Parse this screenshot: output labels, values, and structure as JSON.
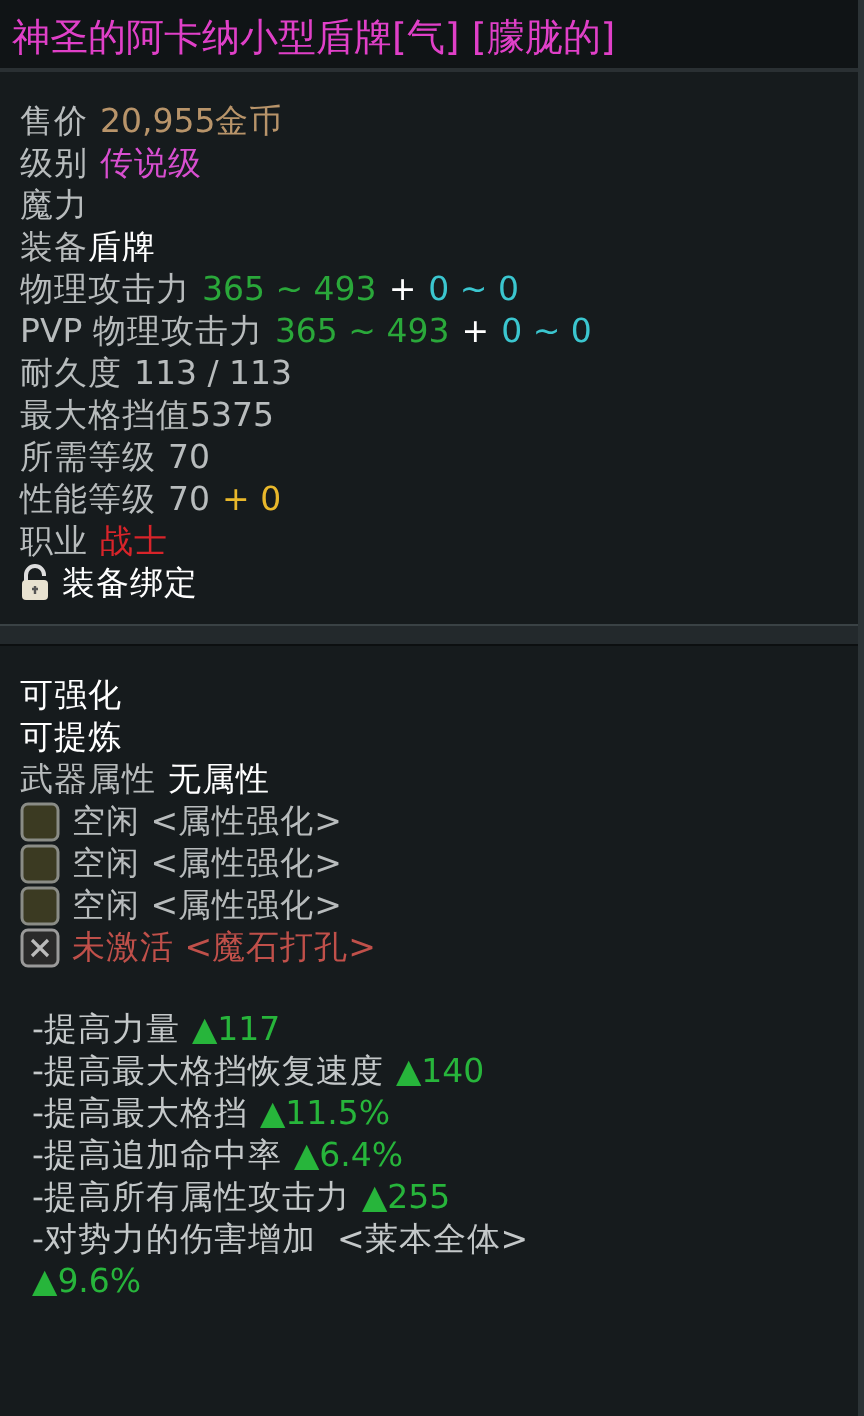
{
  "title": "神圣的阿卡纳小型盾牌[气] [朦胧的]",
  "info": [
    {
      "parts": [
        {
          "text": "售价",
          "kind": "label"
        },
        {
          "text": "20,955金币",
          "kind": "gold"
        }
      ]
    },
    {
      "parts": [
        {
          "text": "级别",
          "kind": "label"
        },
        {
          "text": "传说级",
          "kind": "grade"
        }
      ]
    },
    {
      "parts": [
        {
          "text": "魔力",
          "kind": "label"
        }
      ]
    },
    {
      "parts": [
        {
          "text": "装备",
          "kind": "label"
        },
        {
          "text": "盾牌",
          "kind": "bright",
          "tight": true
        }
      ]
    },
    {
      "parts": [
        {
          "text": "物理攻击力",
          "kind": "label"
        },
        {
          "text": "365 ~ 493",
          "kind": "green"
        },
        {
          "text": "+",
          "kind": "bright"
        },
        {
          "text": "0 ~ 0",
          "kind": "cyan"
        }
      ]
    },
    {
      "parts": [
        {
          "text": "PVP 物理攻击力",
          "kind": "label"
        },
        {
          "text": "365 ~ 493",
          "kind": "green"
        },
        {
          "text": "+",
          "kind": "bright"
        },
        {
          "text": "0 ~ 0",
          "kind": "cyan"
        }
      ]
    },
    {
      "parts": [
        {
          "text": "耐久度",
          "kind": "label"
        },
        {
          "text": "113 / 113",
          "kind": "label"
        }
      ]
    },
    {
      "parts": [
        {
          "text": "最大格挡值5375",
          "kind": "label"
        }
      ]
    },
    {
      "parts": [
        {
          "text": "所需等级",
          "kind": "label"
        },
        {
          "text": "70",
          "kind": "label"
        }
      ]
    },
    {
      "parts": [
        {
          "text": "性能等级",
          "kind": "label"
        },
        {
          "text": "70",
          "kind": "label"
        },
        {
          "text": "+ 0",
          "kind": "yellow"
        }
      ]
    },
    {
      "parts": [
        {
          "text": "职业",
          "kind": "label"
        },
        {
          "text": "战士",
          "kind": "red"
        }
      ]
    }
  ],
  "binding": {
    "text": "装备绑定"
  },
  "flags": [
    {
      "text": "可强化"
    },
    {
      "text": "可提炼"
    }
  ],
  "weapon_attribute": {
    "label": "武器属性",
    "value": "无属性"
  },
  "sockets": [
    {
      "kind": "empty",
      "text": "空闲 <属性强化>"
    },
    {
      "kind": "empty",
      "text": "空闲 <属性强化>"
    },
    {
      "kind": "empty",
      "text": "空闲 <属性强化>"
    },
    {
      "kind": "locked",
      "text": "未激活 <魔石打孔>"
    }
  ],
  "bonuses": [
    {
      "label": "-提高力量",
      "value": "▲117",
      "kind": "inline"
    },
    {
      "label": "-提高最大格挡恢复速度",
      "value": "▲140",
      "kind": "inline"
    },
    {
      "label": "-提高最大格挡",
      "value": "▲11.5%",
      "kind": "inline"
    },
    {
      "label": "-提高追加命中率",
      "value": "▲6.4%",
      "kind": "inline"
    },
    {
      "label": "-提高所有属性攻击力",
      "value": "▲255",
      "kind": "inline"
    },
    {
      "label": "-对势力的伤害增加  <莱本全体>",
      "value": "▲9.6%",
      "kind": "wrap"
    }
  ]
}
